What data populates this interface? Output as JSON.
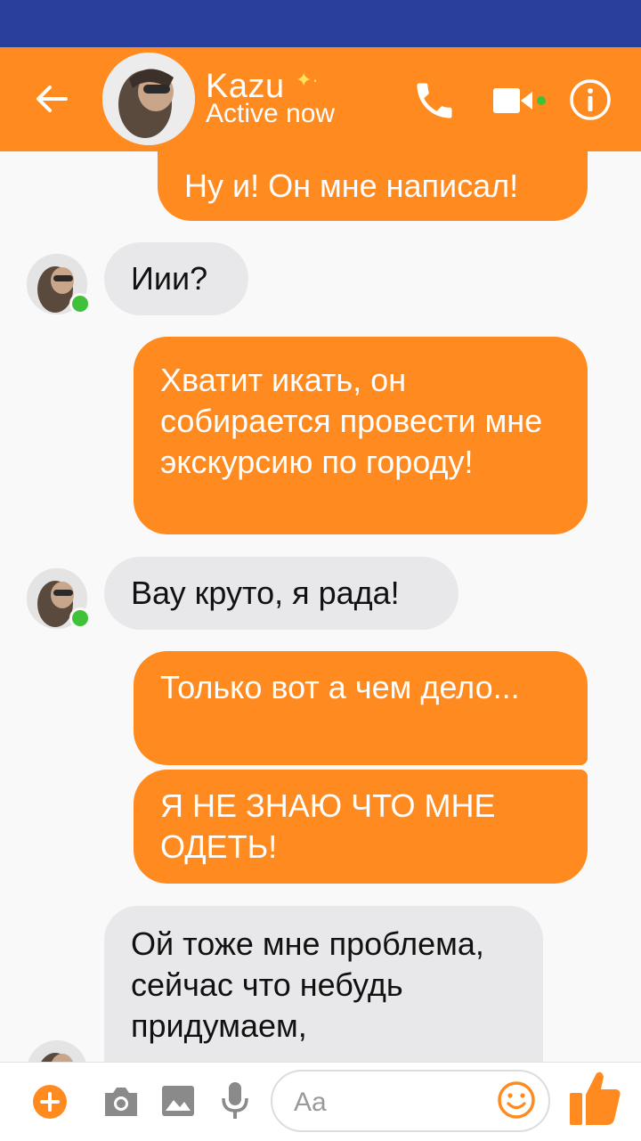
{
  "header": {
    "contact_name": "Kazu",
    "status": "Active now"
  },
  "messages": [
    {
      "side": "out",
      "text": "Ну и! Он мне написал!"
    },
    {
      "side": "in",
      "text": "Иии?"
    },
    {
      "side": "out",
      "text": "Хватит икать, он собирается провести мне экскурсию по городу!"
    },
    {
      "side": "in",
      "text": "Вау круто, я рада!"
    },
    {
      "side": "out",
      "text": "Только вот а чем дело..."
    },
    {
      "side": "out",
      "text": "Я НЕ ЗНАЮ ЧТО МНЕ ОДЕТЬ!"
    },
    {
      "side": "in",
      "text": "Ой тоже мне проблема, сейчас что небудь придумаем,"
    }
  ],
  "composer": {
    "placeholder": "Aa"
  },
  "colors": {
    "accent": "#ff8a1f",
    "status_bar": "#2a3f99",
    "incoming_bubble": "#e8e8ea",
    "online": "#3fc23a"
  },
  "icons": [
    "back-arrow-icon",
    "phone-icon",
    "video-camera-icon",
    "info-icon",
    "plus-icon",
    "camera-icon",
    "image-icon",
    "microphone-icon",
    "emoji-icon",
    "thumbs-up-icon"
  ]
}
